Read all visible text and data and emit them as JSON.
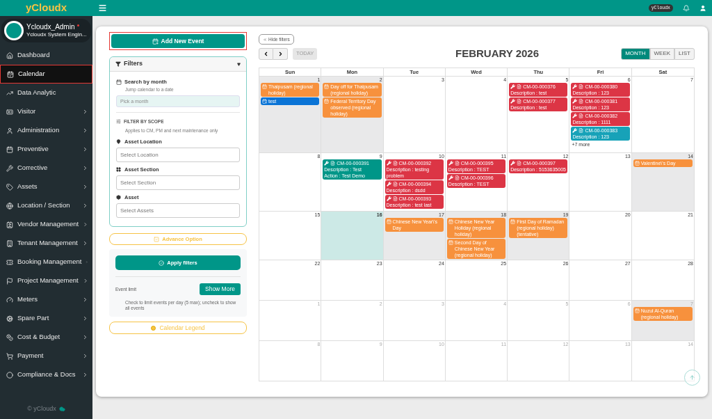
{
  "app": {
    "brand": "yCloudx",
    "badge": "yCloudx"
  },
  "user": {
    "name": "Ycloudx_Admin",
    "role": "Ycloudx System Engin..."
  },
  "sidebar": {
    "items": [
      {
        "label": "Dashboard",
        "selected": false,
        "has_children": false
      },
      {
        "label": "Calendar",
        "selected": true,
        "has_children": false
      },
      {
        "label": "Data Analytic",
        "selected": false,
        "has_children": false
      },
      {
        "label": "Visitor",
        "selected": false,
        "has_children": true
      },
      {
        "label": "Administration",
        "selected": false,
        "has_children": true
      },
      {
        "label": "Preventive",
        "selected": false,
        "has_children": true
      },
      {
        "label": "Corrective",
        "selected": false,
        "has_children": true
      },
      {
        "label": "Assets",
        "selected": false,
        "has_children": true
      },
      {
        "label": "Location / Section",
        "selected": false,
        "has_children": true
      },
      {
        "label": "Vendor Management",
        "selected": false,
        "has_children": true
      },
      {
        "label": "Tenant Management",
        "selected": false,
        "has_children": true
      },
      {
        "label": "Booking Management",
        "selected": false,
        "has_children": true
      },
      {
        "label": "Project Management",
        "selected": false,
        "has_children": true
      },
      {
        "label": "Meters",
        "selected": false,
        "has_children": true
      },
      {
        "label": "Spare Part",
        "selected": false,
        "has_children": true
      },
      {
        "label": "Cost & Budget",
        "selected": false,
        "has_children": true
      },
      {
        "label": "Payment",
        "selected": false,
        "has_children": true
      },
      {
        "label": "Compliance & Docs",
        "selected": false,
        "has_children": true
      }
    ],
    "footer": "© yCloudx"
  },
  "filters_panel": {
    "add_button": "Add New Event",
    "header": "Filters",
    "expanded": true,
    "search_month": {
      "label": "Search by month",
      "hint": "Jump calendar to a date",
      "placeholder": "Pick a month"
    },
    "scope": {
      "label": "FILTER BY SCOPE",
      "hint": "Applies to CM, PM and next maintenance only"
    },
    "fields": [
      {
        "label": "Asset Location",
        "placeholder": "Select Location"
      },
      {
        "label": "Asset Section",
        "placeholder": "Select Section"
      },
      {
        "label": "Asset",
        "placeholder": "Select Assets"
      }
    ],
    "advance_button": "Advance Option",
    "apply_button": "Apply filters",
    "event_limit": {
      "label": "Event limit",
      "button": "Show More",
      "hint": "Check to limit events per day (5 max); uncheck to show all events"
    },
    "legend_button": "Calendar Legend"
  },
  "calendar": {
    "hide_filters": "Hide filters",
    "today_button": "TODAY",
    "title": "FEBRUARY 2026",
    "views": [
      {
        "label": "MONTH",
        "selected": true
      },
      {
        "label": "WEEK",
        "selected": false
      },
      {
        "label": "LIST",
        "selected": false
      }
    ],
    "weekdays": [
      "Sun",
      "Mon",
      "Tue",
      "Wed",
      "Thu",
      "Fri",
      "Sat"
    ],
    "weeks": [
      [
        {
          "day": "1",
          "other_month": false,
          "today": false,
          "shaded": true,
          "events": [
            {
              "kind": "holiday",
              "color": "#f7913d",
              "title": "Thaipusam (regional holiday)"
            },
            {
              "kind": "task",
              "color": "#0b74d6",
              "title": "test"
            }
          ]
        },
        {
          "day": "2",
          "other_month": false,
          "today": false,
          "shaded": true,
          "events": [
            {
              "kind": "holiday",
              "color": "#f7913d",
              "title": "Day off for Thaipusam (regional holiday)"
            },
            {
              "kind": "holiday",
              "color": "#f7913d",
              "title": "Federal Territory Day observed (regional holiday)"
            }
          ]
        },
        {
          "day": "3",
          "other_month": false,
          "today": false,
          "shaded": false
        },
        {
          "day": "4",
          "other_month": false,
          "today": false,
          "shaded": false
        },
        {
          "day": "5",
          "other_month": false,
          "today": false,
          "shaded": false,
          "events": [
            {
              "kind": "work_order",
              "color": "#dc3545",
              "title": "CM-00-000376",
              "lines": [
                "Description : test"
              ]
            },
            {
              "kind": "work_order",
              "color": "#dc3545",
              "title": "CM-00-000377",
              "lines": [
                "Description : test"
              ]
            }
          ]
        },
        {
          "day": "6",
          "other_month": false,
          "today": false,
          "shaded": false,
          "events": [
            {
              "kind": "work_order",
              "color": "#dc3545",
              "title": "CM-00-000380",
              "lines": [
                "Description : 123"
              ]
            },
            {
              "kind": "work_order",
              "color": "#dc3545",
              "title": "CM-00-000381",
              "lines": [
                "Description : 123"
              ]
            },
            {
              "kind": "work_order",
              "color": "#dc3545",
              "title": "CM-00-000382",
              "lines": [
                "Description : 1111"
              ]
            },
            {
              "kind": "work_order",
              "color": "#17a2b8",
              "title": "CM-00-000383",
              "lines": [
                "Description : 123"
              ]
            }
          ],
          "more": "+7 more"
        },
        {
          "day": "7",
          "other_month": false,
          "today": false,
          "shaded": false
        }
      ],
      [
        {
          "day": "8",
          "other_month": false,
          "today": false,
          "shaded": false
        },
        {
          "day": "9",
          "other_month": false,
          "today": false,
          "shaded": false,
          "events": [
            {
              "kind": "work_order",
              "color": "#009688",
              "title": "CM-00-000391",
              "lines": [
                "Description : Test",
                "Action : Test Demo"
              ]
            }
          ]
        },
        {
          "day": "10",
          "other_month": false,
          "today": false,
          "shaded": false,
          "events": [
            {
              "kind": "work_order",
              "color": "#dc3545",
              "title": "CM-00-000392",
              "lines": [
                "Description : testing problem"
              ]
            },
            {
              "kind": "work_order",
              "color": "#dc3545",
              "title": "CM-00-000394",
              "lines": [
                "Description : dsdd"
              ]
            },
            {
              "kind": "work_order",
              "color": "#dc3545",
              "title": "CM-00-000393",
              "lines": [
                "Description : test last"
              ]
            }
          ]
        },
        {
          "day": "11",
          "other_month": false,
          "today": false,
          "shaded": false,
          "events": [
            {
              "kind": "work_order",
              "color": "#dc3545",
              "title": "CM-00-000395",
              "lines": [
                "Description : TEST"
              ]
            },
            {
              "kind": "work_order",
              "color": "#dc3545",
              "title": "CM-00-000396",
              "lines": [
                "Description : TEST"
              ]
            }
          ]
        },
        {
          "day": "12",
          "other_month": false,
          "today": false,
          "shaded": false,
          "events": [
            {
              "kind": "work_order",
              "color": "#dc3545",
              "title": "CM-00-000397",
              "lines": [
                "Description : 5153635005"
              ]
            }
          ]
        },
        {
          "day": "13",
          "other_month": false,
          "today": false,
          "shaded": false
        },
        {
          "day": "14",
          "other_month": false,
          "today": false,
          "shaded": true,
          "events": [
            {
              "kind": "holiday",
              "color": "#f7913d",
              "title": "Valentine\\'s Day"
            }
          ]
        }
      ],
      [
        {
          "day": "15",
          "other_month": false,
          "today": false,
          "shaded": false
        },
        {
          "day": "16",
          "other_month": false,
          "today": true,
          "shaded": false
        },
        {
          "day": "17",
          "other_month": false,
          "today": false,
          "shaded": true,
          "events": [
            {
              "kind": "holiday",
              "color": "#f7913d",
              "title": "Chinese New Year\\'s Day"
            }
          ]
        },
        {
          "day": "18",
          "other_month": false,
          "today": false,
          "shaded": true,
          "events": [
            {
              "kind": "holiday",
              "color": "#f7913d",
              "title": "Chinese New Year Holiday (regional holiday)"
            },
            {
              "kind": "holiday",
              "color": "#f7913d",
              "title": "Second Day of Chinese New Year (regional holiday)"
            }
          ]
        },
        {
          "day": "19",
          "other_month": false,
          "today": false,
          "shaded": true,
          "events": [
            {
              "kind": "holiday",
              "color": "#f7913d",
              "title": "First Day of Ramadan (regional holiday) (tentative)"
            }
          ]
        },
        {
          "day": "20",
          "other_month": false,
          "today": false,
          "shaded": false
        },
        {
          "day": "21",
          "other_month": false,
          "today": false,
          "shaded": false
        }
      ],
      [
        {
          "day": "22",
          "other_month": false,
          "today": false,
          "shaded": false
        },
        {
          "day": "23",
          "other_month": false,
          "today": false,
          "shaded": false
        },
        {
          "day": "24",
          "other_month": false,
          "today": false,
          "shaded": false
        },
        {
          "day": "25",
          "other_month": false,
          "today": false,
          "shaded": false
        },
        {
          "day": "26",
          "other_month": false,
          "today": false,
          "shaded": false
        },
        {
          "day": "27",
          "other_month": false,
          "today": false,
          "shaded": false
        },
        {
          "day": "28",
          "other_month": false,
          "today": false,
          "shaded": false
        }
      ],
      [
        {
          "day": "1",
          "other_month": true,
          "today": false,
          "shaded": false
        },
        {
          "day": "2",
          "other_month": true,
          "today": false,
          "shaded": false
        },
        {
          "day": "3",
          "other_month": true,
          "today": false,
          "shaded": false
        },
        {
          "day": "4",
          "other_month": true,
          "today": false,
          "shaded": false
        },
        {
          "day": "5",
          "other_month": true,
          "today": false,
          "shaded": false
        },
        {
          "day": "6",
          "other_month": true,
          "today": false,
          "shaded": false
        },
        {
          "day": "7",
          "other_month": true,
          "today": false,
          "shaded": true,
          "events": [
            {
              "kind": "holiday",
              "color": "#f7913d",
              "title": "Nuzul Al-Quran (regional holiday)"
            }
          ]
        }
      ],
      [
        {
          "day": "8",
          "other_month": true,
          "today": false,
          "shaded": false
        },
        {
          "day": "9",
          "other_month": true,
          "today": false,
          "shaded": false
        },
        {
          "day": "10",
          "other_month": true,
          "today": false,
          "shaded": false
        },
        {
          "day": "11",
          "other_month": true,
          "today": false,
          "shaded": false
        },
        {
          "day": "12",
          "other_month": true,
          "today": false,
          "shaded": false
        },
        {
          "day": "13",
          "other_month": true,
          "today": false,
          "shaded": false
        },
        {
          "day": "14",
          "other_month": true,
          "today": false,
          "shaded": false
        }
      ]
    ]
  }
}
